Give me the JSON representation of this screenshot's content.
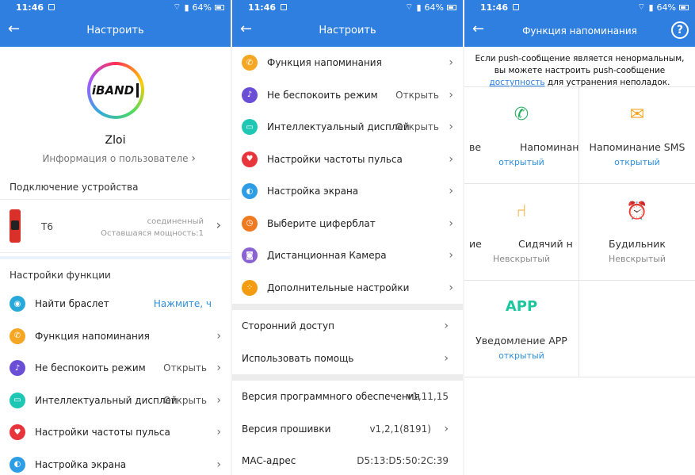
{
  "status_bar": {
    "time": "11:46",
    "battery": "64%"
  },
  "colors": {
    "appbar": "#2f7fe0",
    "link": "#2f8fd8"
  },
  "panel1": {
    "title": "Настроить",
    "logo_text": "iBAND",
    "username": "Zloi",
    "user_info": "Информация о пользователе",
    "device_section": "Подключение устройства",
    "device": {
      "name": "T6",
      "status_line1": "соединенный",
      "status_line2": "Оставшаяся мощность:1"
    },
    "function_section": "Настройки функции",
    "items": [
      {
        "label": "Найти браслет",
        "value": "Нажмите, ч",
        "icon": "location-icon",
        "color": "#29a9d9"
      },
      {
        "label": "Функция напоминания",
        "value": "",
        "icon": "phone-icon",
        "color": "#f5a623"
      },
      {
        "label": "Не беспокоить режим",
        "value": "Открыть",
        "icon": "bell-icon",
        "color": "#6a4fd6"
      },
      {
        "label": "Интеллектуальный дисплей",
        "value": "Открыть",
        "icon": "display-icon",
        "color": "#1ec6b4"
      },
      {
        "label": "Настройки частоты пульса",
        "value": "",
        "icon": "heart-icon",
        "color": "#e8353b"
      },
      {
        "label": "Настройка экрана",
        "value": "",
        "icon": "screen-icon",
        "color": "#2d9de6"
      }
    ]
  },
  "panel2": {
    "title": "Настроить",
    "items": [
      {
        "label": "Функция напоминания",
        "value": "",
        "icon": "phone-icon",
        "color": "#f5a623"
      },
      {
        "label": "Не беспокоить режим",
        "value": "Открыть",
        "icon": "bell-icon",
        "color": "#6a4fd6"
      },
      {
        "label": "Интеллектуальный дисплей",
        "value": "Открыть",
        "icon": "display-icon",
        "color": "#1ec6b4"
      },
      {
        "label": "Настройки частоты пульса",
        "value": "",
        "icon": "heart-icon",
        "color": "#e8353b"
      },
      {
        "label": "Настройка экрана",
        "value": "",
        "icon": "screen-icon",
        "color": "#2d9de6"
      },
      {
        "label": "Выберите циферблат",
        "value": "",
        "icon": "watchface-icon",
        "color": "#f07a1f"
      },
      {
        "label": "Дистанционная Камера",
        "value": "",
        "icon": "camera-icon",
        "color": "#8a63d2"
      },
      {
        "label": "Дополнительные настройки",
        "value": "",
        "icon": "more-icon",
        "color": "#f39c12"
      }
    ],
    "access": [
      {
        "label": "Сторонний доступ"
      },
      {
        "label": "Использовать помощь"
      }
    ],
    "info": [
      {
        "label": "Версия программного обеспечения",
        "value": "v1,11,15"
      },
      {
        "label": "Версия прошивки",
        "value": "v1,2,1(8191)"
      },
      {
        "label": "MAC-адрес",
        "value": "D5:13:D5:50:2C:39"
      }
    ]
  },
  "panel3": {
    "title": "Функция напоминания",
    "notice_part1": "Если push-сообщение является ненормальным, вы можете настроить push-сообщение ",
    "notice_link": "доступность",
    "notice_part2": " для устранения неполадок.",
    "cells": [
      {
        "title": "Напоминание",
        "partial": "ве",
        "state": "открытый",
        "icon": "phone-icon"
      },
      {
        "title": "Напоминание SMS",
        "state": "открытый",
        "icon": "envelope-icon"
      },
      {
        "title": "Сидячий н",
        "partial": "ие",
        "state": "Невскрытый",
        "icon": "sitting-icon"
      },
      {
        "title": "Будильник",
        "state": "Невскрытый",
        "icon": "alarm-icon"
      },
      {
        "title": "Уведомление APP",
        "icon_text": "APP",
        "state": "открытый",
        "icon": "app-icon"
      }
    ]
  }
}
